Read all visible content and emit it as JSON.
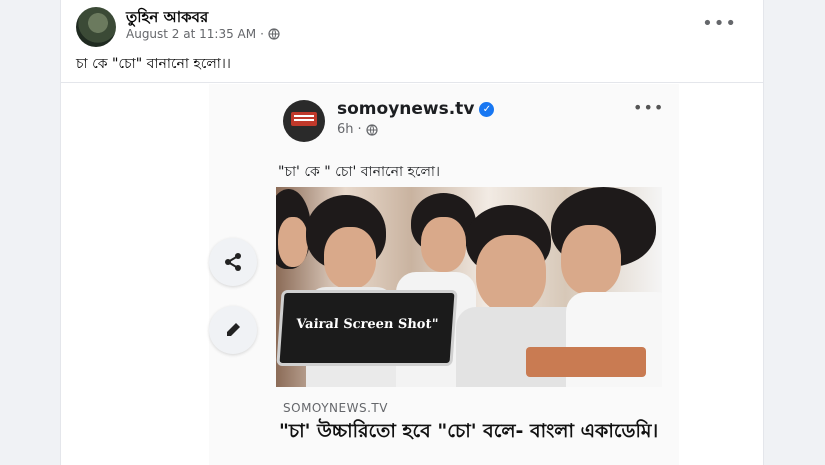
{
  "post": {
    "author": "তুহিন আকবর",
    "timestamp": "August 2 at 11:35 AM",
    "separator": "·",
    "caption": "চা কে \"চো\" বানানো হলো।।",
    "more_icon": "more-horizontal-icon",
    "privacy_icon": "globe-icon"
  },
  "embedded": {
    "page_name": "somoynews.tv",
    "time": "6h",
    "separator": "·",
    "caption": "\"চা' কে \" চো' বানানো  হলো।",
    "watermark": "Vairal Screen Shot\"",
    "link_source": "SOMOYNEWS.TV",
    "headline": "\"চা' উচ্চারিতো হবে \"চো' বলে- বাংলা একাডেমি।"
  },
  "side_actions": {
    "share_icon": "share-icon",
    "edit_icon": "pencil-icon"
  },
  "colors": {
    "accent": "#1877f2",
    "background": "#f0f2f5",
    "card": "#ffffff",
    "muted_text": "#65676b"
  }
}
